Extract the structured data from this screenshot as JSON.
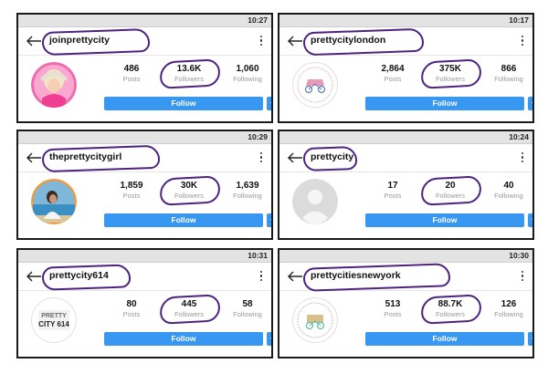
{
  "cards": [
    {
      "username": "joinprettycity",
      "time": "10:27",
      "posts": "486",
      "followers": "13.6K",
      "following": "1,060",
      "avatar": "photo-pink-hat"
    },
    {
      "username": "prettycitylondon",
      "time": "10:17",
      "posts": "2,864",
      "followers": "375K",
      "following": "866",
      "avatar": "logo-london"
    },
    {
      "username": "theprettycitygirl",
      "time": "10:29",
      "posts": "1,859",
      "followers": "30K",
      "following": "1,639",
      "avatar": "photo-girl-sea"
    },
    {
      "username": "prettycity",
      "time": "10:24",
      "posts": "17",
      "followers": "20",
      "following": "40",
      "avatar": "default-silhouette"
    },
    {
      "username": "prettycity614",
      "time": "10:31",
      "posts": "80",
      "followers": "445",
      "following": "58",
      "avatar": "logo-614",
      "avatar_text_1": "PRETTY",
      "avatar_text_2": "CITY 614"
    },
    {
      "username": "prettycitiesnewyork",
      "time": "10:30",
      "posts": "513",
      "followers": "88.7K",
      "following": "126",
      "avatar": "logo-newyork"
    }
  ],
  "labels": {
    "posts": "Posts",
    "followers": "Followers",
    "following": "Following",
    "follow": "Follow"
  },
  "colors": {
    "follow_button": "#3897f0",
    "highlight_marker": "#4d2380"
  },
  "icons": {
    "back": "arrow-left-icon",
    "menu": "kebab-menu-icon",
    "dropdown": "chevron-down-icon"
  }
}
